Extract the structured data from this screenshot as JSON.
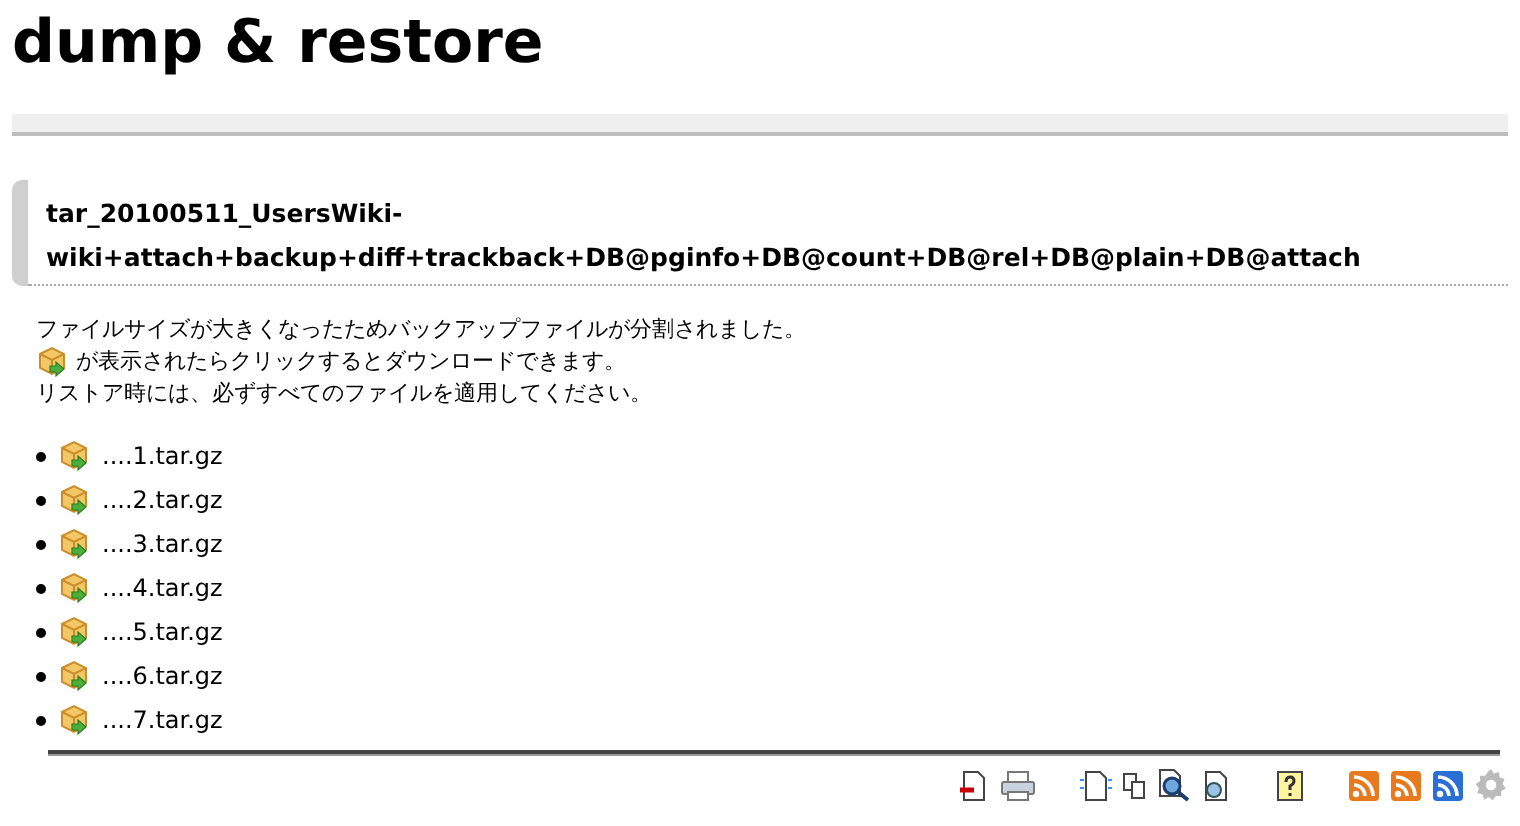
{
  "page_title": "dump & restore",
  "heading": "tar_20100511_UsersWiki-wiki+attach+backup+diff+trackback+DB@pginfo+DB@count+DB@rel+DB@plain+DB@attach",
  "notice": [
    {
      "text": "ファイルサイズが大きくなったためバックアップファイルが分割されました。",
      "icon": false
    },
    {
      "text": "が表示されたらクリックするとダウンロードできます。",
      "icon": true
    },
    {
      "text": "リストア時には、必ずすべてのファイルを適用してください。",
      "icon": false
    }
  ],
  "files": [
    "....1.tar.gz",
    "....2.tar.gz",
    "....3.tar.gz",
    "....4.tar.gz",
    "....5.tar.gz",
    "....6.tar.gz",
    "....7.tar.gz"
  ],
  "toolbar": [
    {
      "kind": "back"
    },
    {
      "kind": "print"
    },
    {
      "kind": "gap"
    },
    {
      "kind": "new"
    },
    {
      "kind": "copy"
    },
    {
      "kind": "search"
    },
    {
      "kind": "recent"
    },
    {
      "kind": "gap"
    },
    {
      "kind": "help"
    },
    {
      "kind": "gap"
    },
    {
      "kind": "rss-orange"
    },
    {
      "kind": "rss-orange"
    },
    {
      "kind": "rss-blue"
    },
    {
      "kind": "gear"
    }
  ]
}
